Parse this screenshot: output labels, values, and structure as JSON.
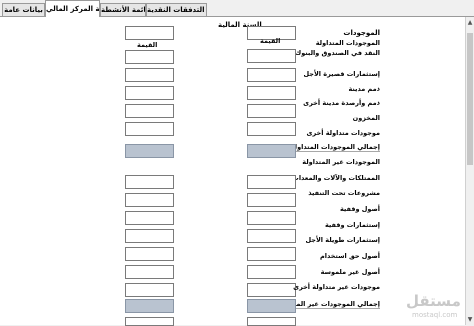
{
  "tabs": [
    {
      "label": "بيانات عامة",
      "active": false
    },
    {
      "label": "قائمة المركز المالي",
      "active": true
    },
    {
      "label": "قائمة الأنشطة",
      "active": false
    },
    {
      "label": "قائمة التدفقات النقدية",
      "active": false
    }
  ],
  "fiscal_year_label": "السنة المالية",
  "column_value_label": "القيمة",
  "current_assets": {
    "section_title": "الموجودات",
    "group_title": "الموجودات المتداولة",
    "items": [
      "النقد في الصندوق والبنوك",
      "إستثمارات قصيرة الأجل",
      "ذمم مدينة",
      "ذمم وأرصدة مدينة أخرى",
      "المخزون",
      "موجودات متداولة أخرى"
    ],
    "total_label": "إجمالي الموجودات المتداولة"
  },
  "non_current_assets": {
    "group_title": "الموجودات غير المتداولة",
    "items": [
      "الممتلكات والآلات والمعدات",
      "مشروعات تحت التنفيذ",
      "أصول وقفية",
      "إستثمارات وقفية",
      "إستثمارات طويلة الأجل",
      "أصول حق استخدام",
      "أصول غير ملموسة",
      "موجودات غير متداولة أخرى"
    ],
    "total_label": "إجمالي الموجودات غير المتداولة"
  },
  "watermark": {
    "arabic": "مستقل",
    "latin": "mostaql.com"
  },
  "colors": {
    "total_field": "#b9c3d0",
    "panel": "#ffffff",
    "background": "#f0f0f0"
  }
}
